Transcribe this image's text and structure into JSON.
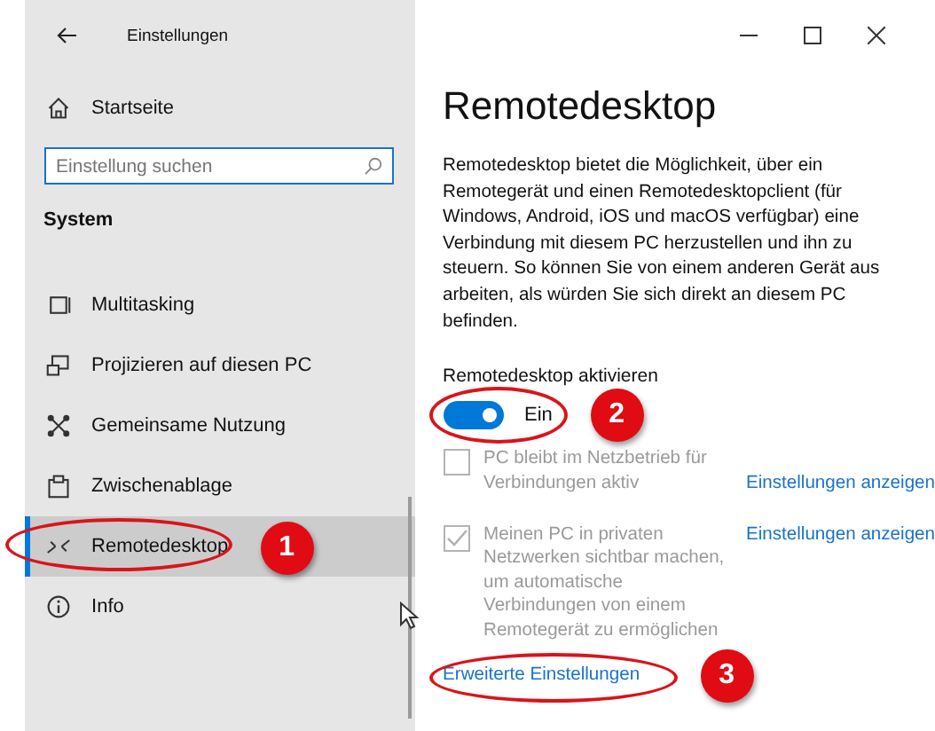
{
  "window": {
    "title": "Einstellungen"
  },
  "sidebar": {
    "home": "Startseite",
    "search": {
      "placeholder": "Einstellung suchen"
    },
    "section": "System",
    "items": [
      {
        "label": "Multitasking",
        "selected": false
      },
      {
        "label": "Projizieren auf diesen PC",
        "selected": false
      },
      {
        "label": "Gemeinsame Nutzung",
        "selected": false
      },
      {
        "label": "Zwischenablage",
        "selected": false
      },
      {
        "label": "Remotedesktop",
        "selected": true,
        "callout": "1"
      },
      {
        "label": "Info",
        "selected": false
      }
    ]
  },
  "content": {
    "title": "Remotedesktop",
    "description": "Remotedesktop bietet die Möglichkeit, über ein Remotegerät und einen Remotedesktopclient (für Windows, Android, iOS und macOS verfügbar) eine Verbindung mit diesem PC herzustellen und ihn zu steuern. So können Sie von einem anderen Gerät aus arbeiten, als würden Sie sich direkt an diesem PC befinden.",
    "toggle": {
      "label": "Remotedesktop aktivieren",
      "state_text": "Ein",
      "on": true,
      "callout": "2"
    },
    "options": [
      {
        "label": "PC bleibt im Netzbetrieb für Verbindungen aktiv",
        "checked": false,
        "disabled": true,
        "link": "Einstellungen anzeigen"
      },
      {
        "label": "Meinen PC in privaten Netzwerken sichtbar machen, um automatische Verbindungen von einem Remotegerät zu ermöglichen",
        "checked": true,
        "disabled": true,
        "link": "Einstellungen anzeigen"
      }
    ],
    "advanced_link": {
      "label": "Erweiterte Einstellungen",
      "callout": "3"
    }
  }
}
